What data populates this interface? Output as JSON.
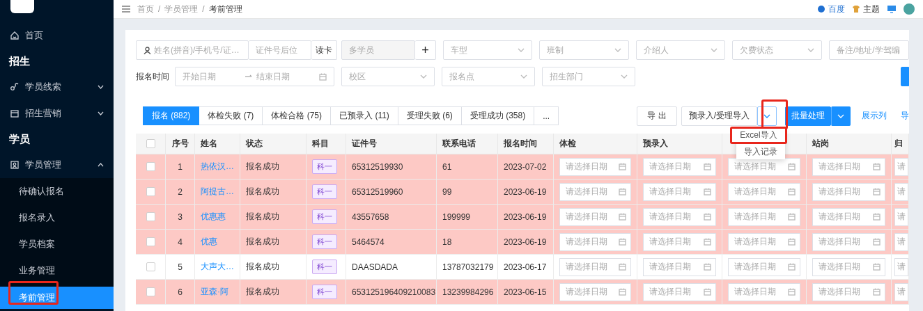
{
  "sidebar": {
    "items": [
      {
        "kind": "link",
        "label": "首页"
      },
      {
        "kind": "heading",
        "label": "招生"
      },
      {
        "kind": "group",
        "label": "学员线索",
        "expanded": false
      },
      {
        "kind": "group",
        "label": "招生营销",
        "expanded": false
      },
      {
        "kind": "heading",
        "label": "学员"
      },
      {
        "kind": "group",
        "label": "学员管理",
        "expanded": true,
        "children": [
          {
            "label": "待确认报名",
            "selected": false,
            "annotated": false
          },
          {
            "label": "报名录入",
            "selected": false,
            "annotated": false
          },
          {
            "label": "学员档案",
            "selected": false,
            "annotated": false
          },
          {
            "label": "业务管理",
            "selected": false,
            "annotated": false
          },
          {
            "label": "考前管理",
            "selected": true,
            "annotated": true
          }
        ]
      }
    ]
  },
  "header": {
    "breadcrumb": [
      "首页",
      "学员管理",
      "考前管理"
    ],
    "separator": "/",
    "links": [
      "百度",
      "主题"
    ]
  },
  "filters": {
    "row_1": [
      {
        "kind": "search",
        "placeholder": "姓名(拼音)/手机号/证…"
      },
      {
        "kind": "text",
        "placeholder": "证件号后位"
      },
      {
        "kind": "button",
        "label": "读卡"
      },
      {
        "kind": "disabled",
        "placeholder": "多学员"
      },
      {
        "kind": "add",
        "label": "+"
      },
      {
        "kind": "select",
        "placeholder": "车型"
      },
      {
        "kind": "select",
        "placeholder": "班制"
      },
      {
        "kind": "select",
        "placeholder": "介绍人"
      },
      {
        "kind": "select",
        "placeholder": "欠费状态"
      },
      {
        "kind": "text",
        "placeholder": "备注/地址/学驾编"
      }
    ],
    "row_2": [
      {
        "kind": "label",
        "label": "报名时间"
      },
      {
        "kind": "daterange",
        "start": "开始日期",
        "end": "结束日期"
      },
      {
        "kind": "select",
        "placeholder": "校区"
      },
      {
        "kind": "select",
        "placeholder": "报名点"
      },
      {
        "kind": "select",
        "placeholder": "招生部门"
      },
      {
        "kind": "search-button"
      }
    ]
  },
  "tabs": [
    {
      "label": "报名 (882)",
      "selected": true
    },
    {
      "label": "体检失败 (7)",
      "selected": false
    },
    {
      "label": "体检合格 (75)",
      "selected": false
    },
    {
      "label": "已预录入 (11)",
      "selected": false
    },
    {
      "label": "受理失败 (6)",
      "selected": false
    },
    {
      "label": "受理成功 (358)",
      "selected": false
    },
    {
      "label": "...",
      "selected": false
    }
  ],
  "toolbar": {
    "export": "导 出",
    "import": "预录入/受理导入",
    "toggle_annotated": true,
    "batch": "批量处理",
    "links": [
      "展示列",
      "导"
    ]
  },
  "dropdown": {
    "open": true,
    "items": [
      {
        "label": "Excel导入",
        "annotated": true
      },
      {
        "label": "导入记录",
        "annotated": false
      }
    ]
  },
  "table": {
    "select_all": {
      "checked": false
    },
    "columns": [
      {
        "kind": "index",
        "label": "序号"
      },
      {
        "kind": "link",
        "label": "姓名"
      },
      {
        "kind": "text",
        "label": "状态"
      },
      {
        "kind": "tag",
        "label": "科目"
      },
      {
        "kind": "text",
        "label": "证件号"
      },
      {
        "kind": "text",
        "label": "联系电话"
      },
      {
        "kind": "text",
        "label": "报名时间"
      },
      {
        "kind": "date",
        "label": "体检"
      },
      {
        "kind": "date",
        "label": "预录入"
      },
      {
        "kind": "date"
      },
      {
        "kind": "date",
        "label": "站岗"
      },
      {
        "kind": "date",
        "label": "归"
      }
    ],
    "rows": [
      {
        "highlighted": true,
        "checked": false,
        "cells": [
          "1",
          "热依汉…",
          "报名成功",
          "科一",
          "65312519930",
          "61",
          "2023-07-02",
          "请选择日期",
          "请选择日期",
          "请选择日期",
          "请选择日期",
          "请"
        ]
      },
      {
        "highlighted": true,
        "checked": false,
        "cells": [
          "2",
          "阿提古…",
          "报名成功",
          "科一",
          "65312519960",
          "99",
          "2023-06-19",
          "请选择日期",
          "请选择日期",
          "请选择日期",
          "请选择日期",
          "请"
        ]
      },
      {
        "highlighted": true,
        "checked": false,
        "cells": [
          "3",
          "优惠惠",
          "报名成功",
          "科一",
          "43557658",
          "199999",
          "2023-06-19",
          "请选择日期",
          "请选择日期",
          "请选择日期",
          "请选择日期",
          "请"
        ]
      },
      {
        "highlighted": true,
        "checked": false,
        "cells": [
          "4",
          "优惠",
          "报名成功",
          "科一",
          "5464574",
          "18",
          "2023-06-19",
          "请选择日期",
          "请选择日期",
          "请选择日期",
          "请选择日期",
          "请"
        ]
      },
      {
        "highlighted": false,
        "checked": false,
        "cells": [
          "5",
          "大声大…",
          "报名成功",
          "科一",
          "DAASDADA",
          "13787032179",
          "2023-06-17",
          "请选择日期",
          "请选择日期",
          "请选择日期",
          "请选择日期",
          "请"
        ]
      },
      {
        "highlighted": true,
        "checked": false,
        "cells": [
          "6",
          "亚森·阿",
          "报名成功",
          "科一",
          "653125196409210083",
          "13239984296",
          "2023-06-15",
          "请选择日期",
          "请选择日期",
          "请选择日期",
          "请选择日期",
          "请"
        ]
      }
    ]
  }
}
